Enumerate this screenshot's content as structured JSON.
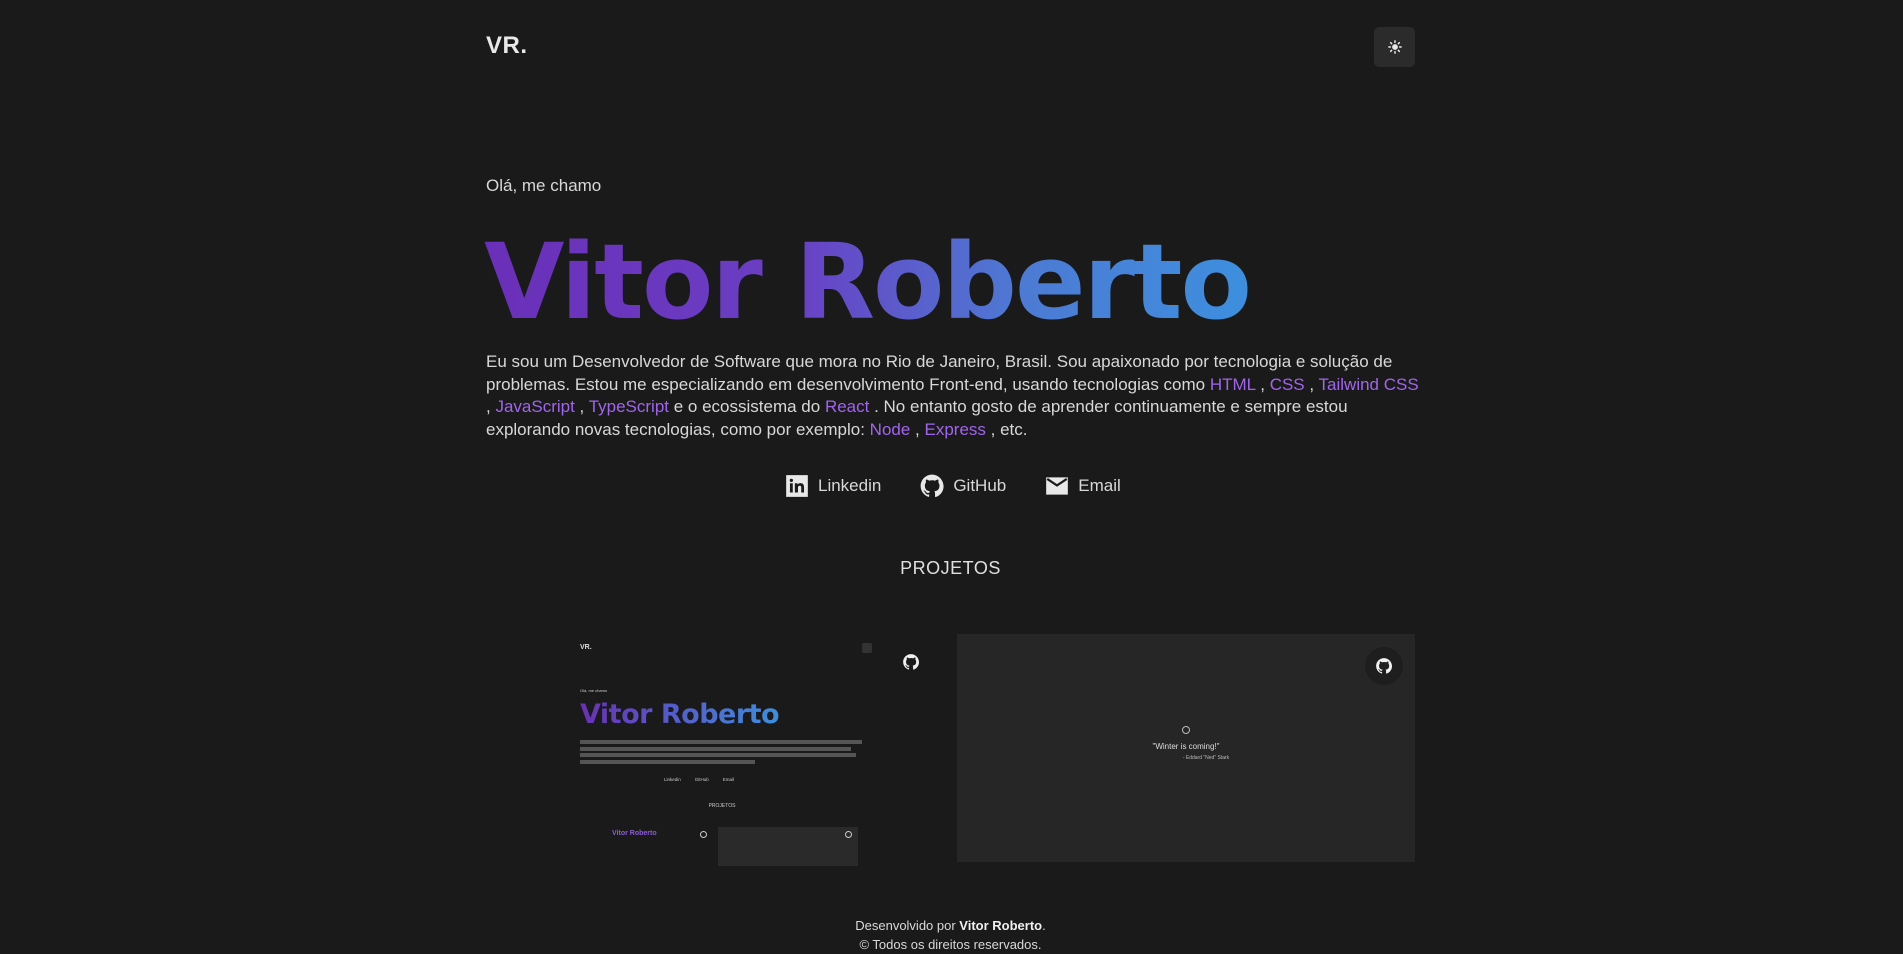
{
  "header": {
    "logo": "VR.",
    "theme_toggle_icon": "sun-icon"
  },
  "hero": {
    "greeting": "Olá, me chamo",
    "name": "Vitor Roberto",
    "bio": {
      "t1": "Eu sou um Desenvolvedor de Software que mora no Rio de Janeiro, Brasil. Sou apaixonado por tecnologia e solução de problemas. Estou me especializando em desenvolvimento Front-end, usando tecnologias como ",
      "html": "HTML",
      "sep1": " , ",
      "css": "CSS",
      "sep2": " , ",
      "tailwind": "Tailwind CSS",
      "sep3": " , ",
      "javascript": "JavaScript",
      "sep4": " , ",
      "typescript": "TypeScript",
      "t2": " e o ecossistema do ",
      "react": "React",
      "t3": " . No entanto gosto de aprender continuamente e sempre estou explorando novas tecnologias, como por exemplo: ",
      "node": "Node",
      "sep5": " , ",
      "express": "Express",
      "t4": " , etc."
    }
  },
  "socials": [
    {
      "label": "Linkedin",
      "icon": "linkedin-icon"
    },
    {
      "label": "GitHub",
      "icon": "github-icon"
    },
    {
      "label": "Email",
      "icon": "mail-icon"
    }
  ],
  "projects": {
    "heading": "PROJETOS",
    "project1_preview": {
      "logo": "VR.",
      "greeting": "Olá, me chamo",
      "name": "Vitor Roberto",
      "projects": "PROJETOS",
      "sub_name": "Vitor Roberto",
      "social": [
        "Linkedin",
        "GitHub",
        "Email"
      ]
    },
    "project2_preview": {
      "quote": "\"Winter is coming!\"",
      "author": "- Eddard \"Ned\" Stark"
    }
  },
  "footer": {
    "line1_prefix": "Desenvolvido por ",
    "line1_name": "Vitor Roberto",
    "line1_suffix": ".",
    "line2": "© Todos os direitos reservados."
  },
  "colors": {
    "background": "#1a1a1a",
    "accent": "#a164ec",
    "gradient_start": "#6a2fb8",
    "gradient_end": "#3d8fdf"
  }
}
